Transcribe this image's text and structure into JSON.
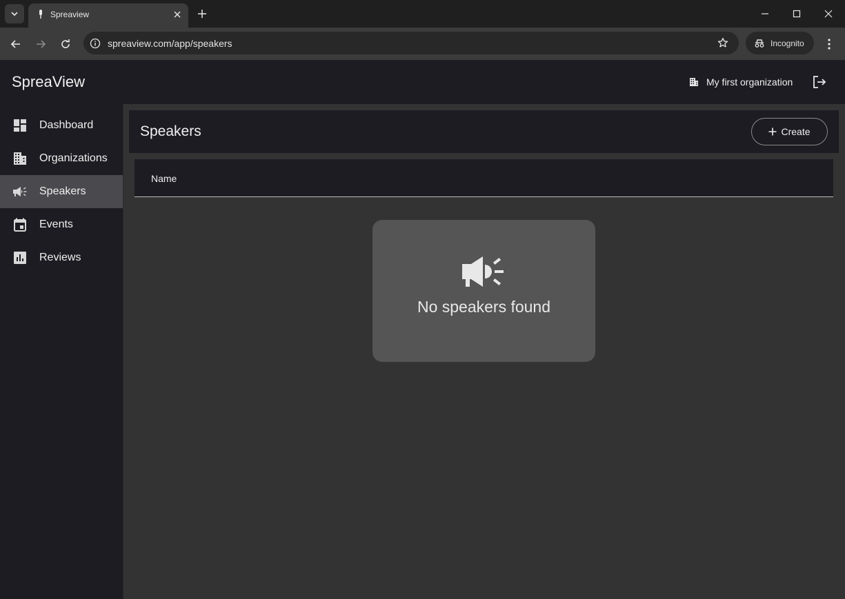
{
  "browser": {
    "tab_title": "Spreaview",
    "url": "spreaview.com/app/speakers",
    "incognito_label": "Incognito"
  },
  "app": {
    "brand": "SpreaView",
    "organization": "My first organization"
  },
  "sidebar": {
    "items": [
      {
        "label": "Dashboard",
        "icon": "dashboard-icon"
      },
      {
        "label": "Organizations",
        "icon": "building-icon"
      },
      {
        "label": "Speakers",
        "icon": "megaphone-icon",
        "active": true
      },
      {
        "label": "Events",
        "icon": "calendar-icon"
      },
      {
        "label": "Reviews",
        "icon": "chart-icon"
      }
    ]
  },
  "page": {
    "title": "Speakers",
    "create_label": "Create",
    "table": {
      "columns": [
        "Name"
      ]
    },
    "empty_message": "No speakers found"
  },
  "colors": {
    "appbar": "#1d1c22",
    "content_bg": "#333333",
    "active_nav": "#4a4a4e",
    "empty_card": "#555555"
  }
}
